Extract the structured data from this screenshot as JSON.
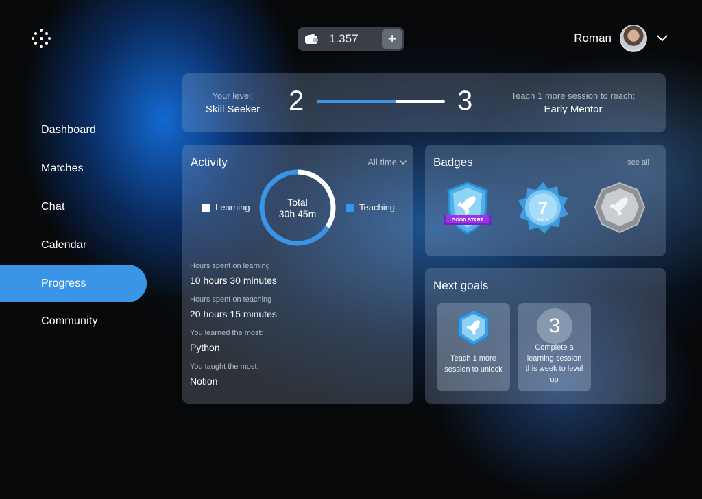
{
  "header": {
    "logo_icon": "dots-logo-icon",
    "wallet": {
      "icon": "wallet-icon",
      "value": "1.357",
      "add_label": "+"
    },
    "user": {
      "name": "Roman",
      "menu_icon": "chevron-down-icon"
    }
  },
  "sidebar": {
    "items": [
      {
        "label": "Dashboard"
      },
      {
        "label": "Matches"
      },
      {
        "label": "Chat"
      },
      {
        "label": "Calendar"
      },
      {
        "label": "Progress",
        "active": true
      },
      {
        "label": "Community"
      }
    ]
  },
  "level": {
    "your_level_label": "Your level:",
    "level_name": "Skill Seeker",
    "current": "2",
    "next": "3",
    "progress": 0.62,
    "next_hint": "Teach 1 more session to reach:",
    "next_name": "Early Mentor"
  },
  "activity": {
    "title": "Activity",
    "filter": "All time",
    "total_label": "Total",
    "total_value": "30h 45m",
    "legend": [
      {
        "label": "Learning",
        "color": "#ffffff"
      },
      {
        "label": "Teaching",
        "color": "#3b95e6"
      }
    ],
    "learning_fraction": 0.34,
    "stats": [
      {
        "label": "Hours spent on learning",
        "value": "10 hours 30 minutes"
      },
      {
        "label": "Hours spent on teaching",
        "value": "20 hours 15 minutes"
      },
      {
        "label": "You learned the most:",
        "value": "Python"
      },
      {
        "label": "You taught the most:",
        "value": "Notion"
      }
    ]
  },
  "badges": {
    "title": "Badges",
    "see_all": "see all",
    "items": [
      {
        "icon": "rocket-shield-badge-icon",
        "ribbon": "GOOD START"
      },
      {
        "icon": "seven-days-star-badge-icon",
        "number": "7",
        "caption": "DAYS"
      },
      {
        "icon": "locked-rocket-badge-icon"
      }
    ]
  },
  "goals": {
    "title": "Next goals",
    "items": [
      {
        "icon": "rocket-badge-icon",
        "text": "Teach 1 more session to unlock"
      },
      {
        "number": "3",
        "text": "Complete a learning session this week to level up"
      }
    ]
  },
  "colors": {
    "accent": "#3b95e6",
    "background": "#07080a"
  }
}
